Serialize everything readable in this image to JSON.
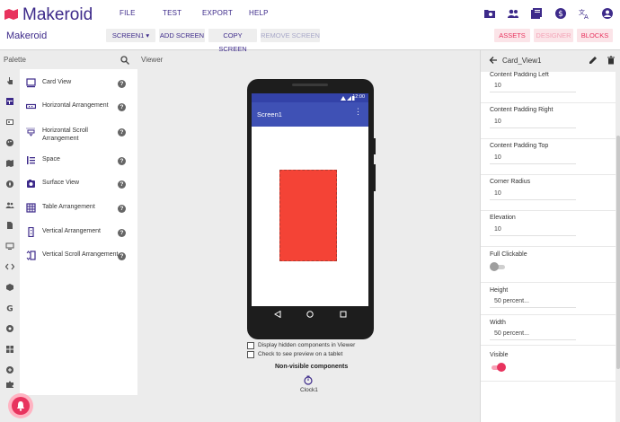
{
  "app": {
    "logo_text": "Makeroid",
    "project_name": "Makeroid",
    "brand_color": "#3d2a8a",
    "accent_pink": "#e8335e"
  },
  "menu": [
    {
      "label": "FILE"
    },
    {
      "label": "TEST"
    },
    {
      "label": "EXPORT"
    },
    {
      "label": "HELP"
    }
  ],
  "top_icons": [
    "folder-star-icon",
    "people-icon",
    "library-books-icon",
    "dollar-icon",
    "translate-icon",
    "account-icon"
  ],
  "toolbar": {
    "screen_select": "SCREEN1 ▾",
    "add_screen": "ADD SCREEN",
    "copy_screen": "COPY SCREEN",
    "remove_screen": "REMOVE SCREEN",
    "assets": "ASSETS",
    "designer": "DESIGNER",
    "blocks": "BLOCKS"
  },
  "palette": {
    "title": "Palette",
    "items": [
      {
        "label": "Card View",
        "icon": "card-view-icon"
      },
      {
        "label": "Horizontal Arrangement",
        "icon": "horizontal-arrangement-icon"
      },
      {
        "label": "Horizontal Scroll Arrangement",
        "icon": "horizontal-scroll-icon"
      },
      {
        "label": "Space",
        "icon": "space-icon"
      },
      {
        "label": "Surface View",
        "icon": "surface-view-icon"
      },
      {
        "label": "Table Arrangement",
        "icon": "table-icon"
      },
      {
        "label": "Vertical Arrangement",
        "icon": "vertical-arrangement-icon"
      },
      {
        "label": "Vertical Scroll Arrangement",
        "icon": "vertical-scroll-icon"
      }
    ],
    "help_glyph": "?"
  },
  "rail_icons": [
    "user-interface-icon",
    "layout-icon",
    "media-icon",
    "drawing-icon",
    "maps-icon",
    "sensors-icon",
    "social-icon",
    "storage-icon",
    "connectivity-icon",
    "code-icon",
    "lego-icon",
    "google-icon",
    "dynamic-icon",
    "widgets-icon",
    "extension-icon",
    "puzzle-icon"
  ],
  "viewer": {
    "title": "Viewer",
    "status_time": "12:00",
    "screen_title": "Screen1",
    "menu_glyph": "⋮",
    "card_color": "#f44336",
    "appbar_color": "#3f51b5",
    "show_hidden": "Display hidden components in Viewer",
    "tablet_preview": "Check to see preview on a tablet",
    "nonvisible_title": "Non-visible components",
    "clock_label": "Clock1"
  },
  "properties": {
    "component": "Card_View1",
    "items": [
      {
        "label": "Content Padding Left",
        "value": "10"
      },
      {
        "label": "Content Padding Right",
        "value": "10"
      },
      {
        "label": "Content Padding Top",
        "value": "10"
      },
      {
        "label": "Corner Radius",
        "value": "10"
      },
      {
        "label": "Elevation",
        "value": "10"
      },
      {
        "label": "Full Clickable",
        "value": "off"
      },
      {
        "label": "Height",
        "value": "50 percent..."
      },
      {
        "label": "Width",
        "value": "50 percent..."
      },
      {
        "label": "Visible",
        "value": "on"
      }
    ]
  }
}
